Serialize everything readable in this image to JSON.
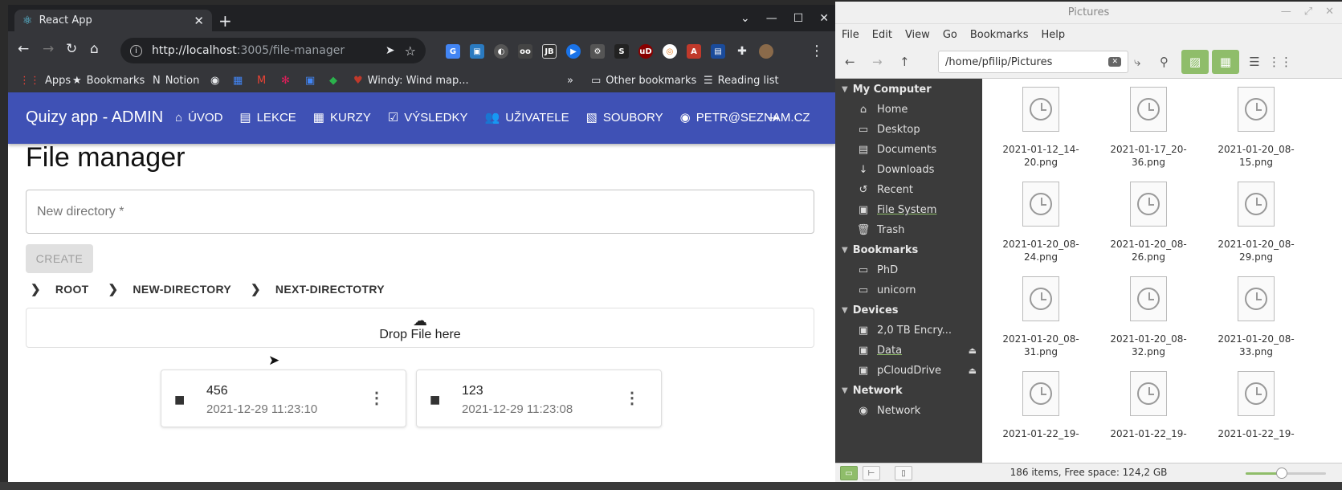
{
  "chrome": {
    "tab_title": "React App",
    "url_host": "http://localhost",
    "url_rest": ":3005/file-manager",
    "bookmarks": [
      "Apps",
      "Bookmarks",
      "Notion",
      "Windy: Wind map...",
      "Other bookmarks",
      "Reading list"
    ]
  },
  "app": {
    "brand": "Quizy app - ADMIN",
    "nav": [
      "ÚVOD",
      "LEKCE",
      "KURZY",
      "VÝSLEDKY",
      "UŽIVATELE",
      "SOUBORY",
      "PETR@SEZNAM.CZ"
    ],
    "page_title": "File manager",
    "new_dir_placeholder": "New directory *",
    "create_label": "CREATE",
    "breadcrumbs": [
      "ROOT",
      "NEW-DIRECTORY",
      "NEXT-DIRECTOTRY"
    ],
    "drop_label": "Drop File here",
    "folders": [
      {
        "name": "456",
        "date": "2021-12-29 11:23:10"
      },
      {
        "name": "123",
        "date": "2021-12-29 11:23:08"
      }
    ]
  },
  "nemo": {
    "title": "Pictures",
    "menu": [
      "File",
      "Edit",
      "View",
      "Go",
      "Bookmarks",
      "Help"
    ],
    "path": "/home/pfilip/Pictures",
    "sections": {
      "computer": "My Computer",
      "bookmarks": "Bookmarks",
      "devices": "Devices",
      "network": "Network"
    },
    "computer_items": [
      "Home",
      "Desktop",
      "Documents",
      "Downloads",
      "Recent",
      "File System",
      "Trash"
    ],
    "bookmark_items": [
      "PhD",
      "unicorn"
    ],
    "device_items": [
      "2,0 TB Encry...",
      "Data",
      "pCloudDrive"
    ],
    "network_items": [
      "Network"
    ],
    "files": [
      {
        "l1": "2021-01-12_14-",
        "l2": "20.png"
      },
      {
        "l1": "2021-01-17_20-",
        "l2": "36.png"
      },
      {
        "l1": "2021-01-20_08-",
        "l2": "15.png"
      },
      {
        "l1": "2021-01-20_08-",
        "l2": "24.png"
      },
      {
        "l1": "2021-01-20_08-",
        "l2": "26.png"
      },
      {
        "l1": "2021-01-20_08-",
        "l2": "29.png"
      },
      {
        "l1": "2021-01-20_08-",
        "l2": "31.png"
      },
      {
        "l1": "2021-01-20_08-",
        "l2": "32.png"
      },
      {
        "l1": "2021-01-20_08-",
        "l2": "33.png"
      },
      {
        "l1": "2021-01-22_19-",
        "l2": ""
      },
      {
        "l1": "2021-01-22_19-",
        "l2": ""
      },
      {
        "l1": "2021-01-22_19-",
        "l2": ""
      }
    ],
    "status": "186 items, Free space: 124,2 GB",
    "zoom_fraction": 0.45
  },
  "colors": {
    "appbar": "#3f51b5",
    "nemo_accent": "#8fbd6a"
  }
}
